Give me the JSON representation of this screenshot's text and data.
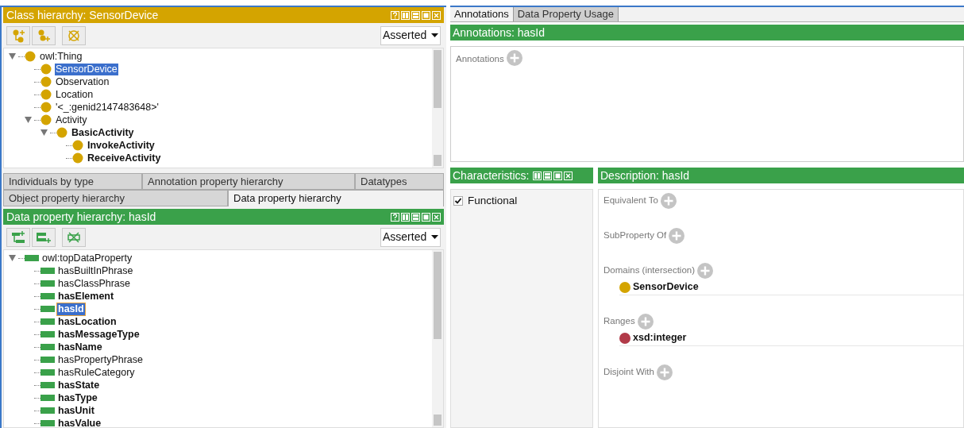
{
  "class_panel": {
    "title": "Class hierarchy: SensorDevice",
    "view": "Asserted",
    "tree": [
      {
        "label": "owl:Thing",
        "bold": false,
        "selected": false,
        "expanded": true,
        "children": [
          {
            "label": "SensorDevice",
            "bold": false,
            "selected": true
          },
          {
            "label": "Observation",
            "bold": false,
            "selected": false
          },
          {
            "label": "Location",
            "bold": false,
            "selected": false
          },
          {
            "label": "'<_:genid2147483648>'",
            "bold": false,
            "selected": false
          },
          {
            "label": "Activity",
            "bold": false,
            "selected": false,
            "expanded": true,
            "children": [
              {
                "label": "BasicActivity",
                "bold": true,
                "selected": false,
                "expanded": true,
                "children": [
                  {
                    "label": "InvokeActivity",
                    "bold": true,
                    "selected": false
                  },
                  {
                    "label": "ReceiveActivity",
                    "bold": true,
                    "selected": false
                  }
                ]
              }
            ]
          }
        ]
      }
    ]
  },
  "view_tabs": [
    [
      {
        "label": "Individuals by type",
        "selected": false
      },
      {
        "label": "Annotation property hierarchy",
        "selected": false
      },
      {
        "label": "Datatypes",
        "selected": false
      }
    ],
    [
      {
        "label": "Object property hierarchy",
        "selected": false
      },
      {
        "label": "Data property hierarchy",
        "selected": true
      }
    ]
  ],
  "data_panel": {
    "title": "Data property hierarchy: hasId",
    "view": "Asserted",
    "tree": [
      {
        "label": "owl:topDataProperty",
        "bold": false,
        "selected": false,
        "expanded": true,
        "children": [
          {
            "label": "hasBuiltInPhrase",
            "bold": false,
            "selected": false
          },
          {
            "label": "hasClassPhrase",
            "bold": false,
            "selected": false
          },
          {
            "label": "hasElement",
            "bold": true,
            "selected": false
          },
          {
            "label": "hasId",
            "bold": true,
            "selected": true
          },
          {
            "label": "hasLocation",
            "bold": true,
            "selected": false
          },
          {
            "label": "hasMessageType",
            "bold": true,
            "selected": false
          },
          {
            "label": "hasName",
            "bold": true,
            "selected": false
          },
          {
            "label": "hasPropertyPhrase",
            "bold": false,
            "selected": false
          },
          {
            "label": "hasRuleCategory",
            "bold": false,
            "selected": false
          },
          {
            "label": "hasState",
            "bold": true,
            "selected": false
          },
          {
            "label": "hasType",
            "bold": true,
            "selected": false
          },
          {
            "label": "hasUnit",
            "bold": true,
            "selected": false
          },
          {
            "label": "hasValue",
            "bold": true,
            "selected": false
          }
        ]
      }
    ]
  },
  "detail_tabs": [
    {
      "label": "Annotations",
      "selected": true
    },
    {
      "label": "Data Property Usage",
      "selected": false
    }
  ],
  "annotations": {
    "title": "Annotations: hasId",
    "label": "Annotations"
  },
  "characteristics": {
    "title": "Characteristics:",
    "items": [
      {
        "label": "Functional",
        "checked": true
      }
    ]
  },
  "description": {
    "title": "Description: hasId",
    "sections": [
      {
        "label": "Equivalent To"
      },
      {
        "label": "SubProperty Of"
      },
      {
        "label": "Domains (intersection)",
        "entries": [
          {
            "label": "SensorDevice",
            "kind": "class"
          }
        ]
      },
      {
        "label": "Ranges",
        "entries": [
          {
            "label": "xsd:integer",
            "kind": "datatype"
          }
        ]
      },
      {
        "label": "Disjoint With"
      }
    ]
  }
}
